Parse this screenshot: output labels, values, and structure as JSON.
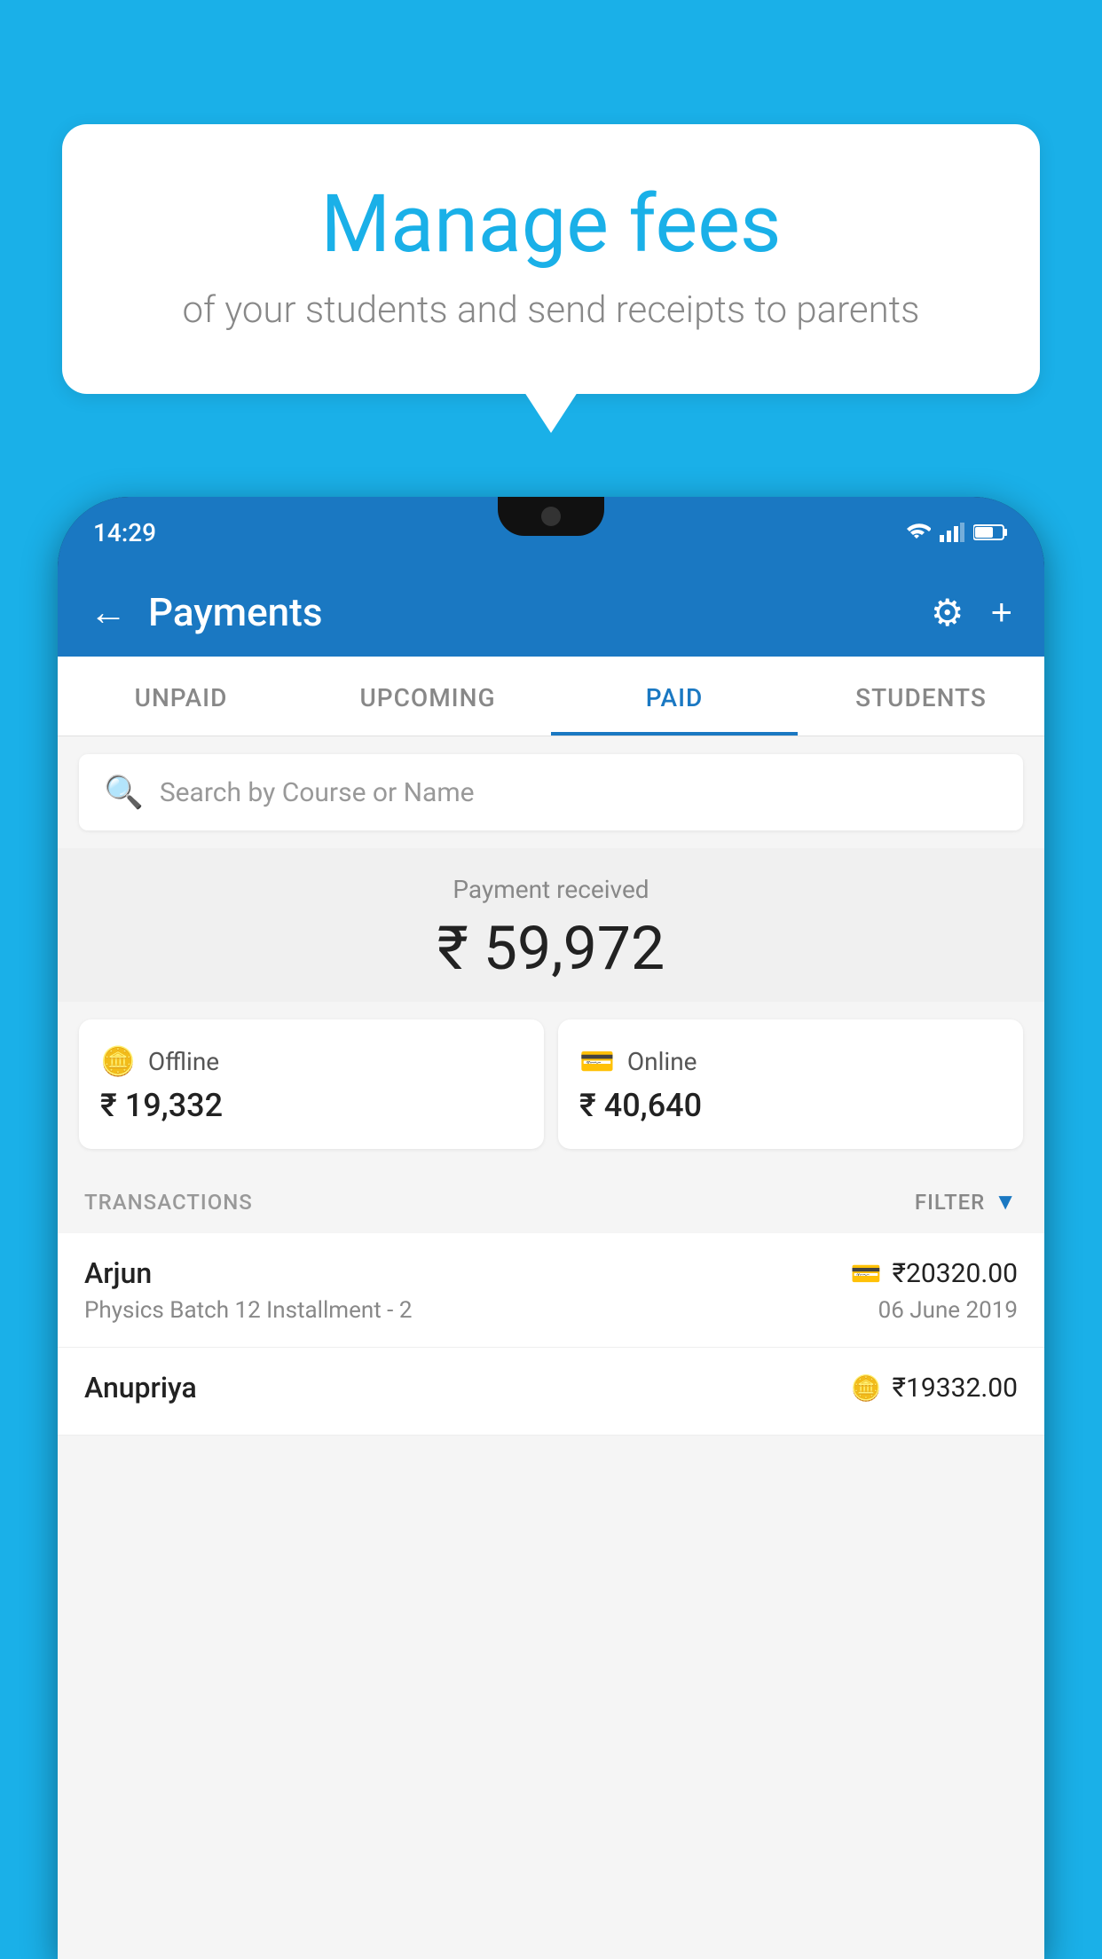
{
  "background_color": "#1ab0e8",
  "speech_bubble": {
    "title": "Manage fees",
    "subtitle": "of your students and send receipts to parents"
  },
  "phone": {
    "status_bar": {
      "time": "14:29"
    },
    "header": {
      "title": "Payments",
      "back_label": "←",
      "settings_label": "⚙",
      "add_label": "+"
    },
    "tabs": [
      {
        "label": "UNPAID",
        "active": false
      },
      {
        "label": "UPCOMING",
        "active": false
      },
      {
        "label": "PAID",
        "active": true
      },
      {
        "label": "STUDENTS",
        "active": false
      }
    ],
    "search": {
      "placeholder": "Search by Course or Name"
    },
    "payment_summary": {
      "label": "Payment received",
      "amount": "₹ 59,972"
    },
    "payment_cards": [
      {
        "type": "Offline",
        "amount": "₹ 19,332",
        "icon": "💳"
      },
      {
        "type": "Online",
        "amount": "₹ 40,640",
        "icon": "💳"
      }
    ],
    "transactions": {
      "label": "TRANSACTIONS",
      "filter_label": "FILTER",
      "rows": [
        {
          "name": "Arjun",
          "course": "Physics Batch 12 Installment - 2",
          "amount": "₹20320.00",
          "date": "06 June 2019",
          "payment_type": "card"
        },
        {
          "name": "Anupriya",
          "course": "",
          "amount": "₹19332.00",
          "date": "",
          "payment_type": "offline"
        }
      ]
    }
  }
}
